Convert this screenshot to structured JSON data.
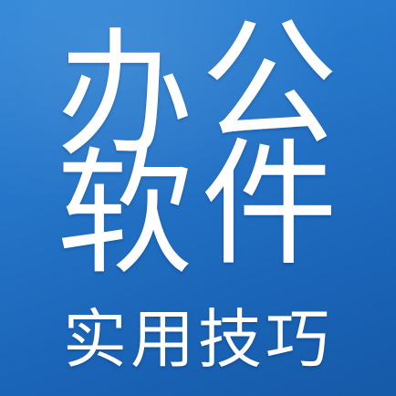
{
  "title": {
    "chars": [
      "办",
      "公",
      "软",
      "件"
    ]
  },
  "subtitle": "实用技巧",
  "colors": {
    "background_top": "#2f86d8",
    "background_bottom": "#165aa8",
    "text": "#ffffff"
  }
}
